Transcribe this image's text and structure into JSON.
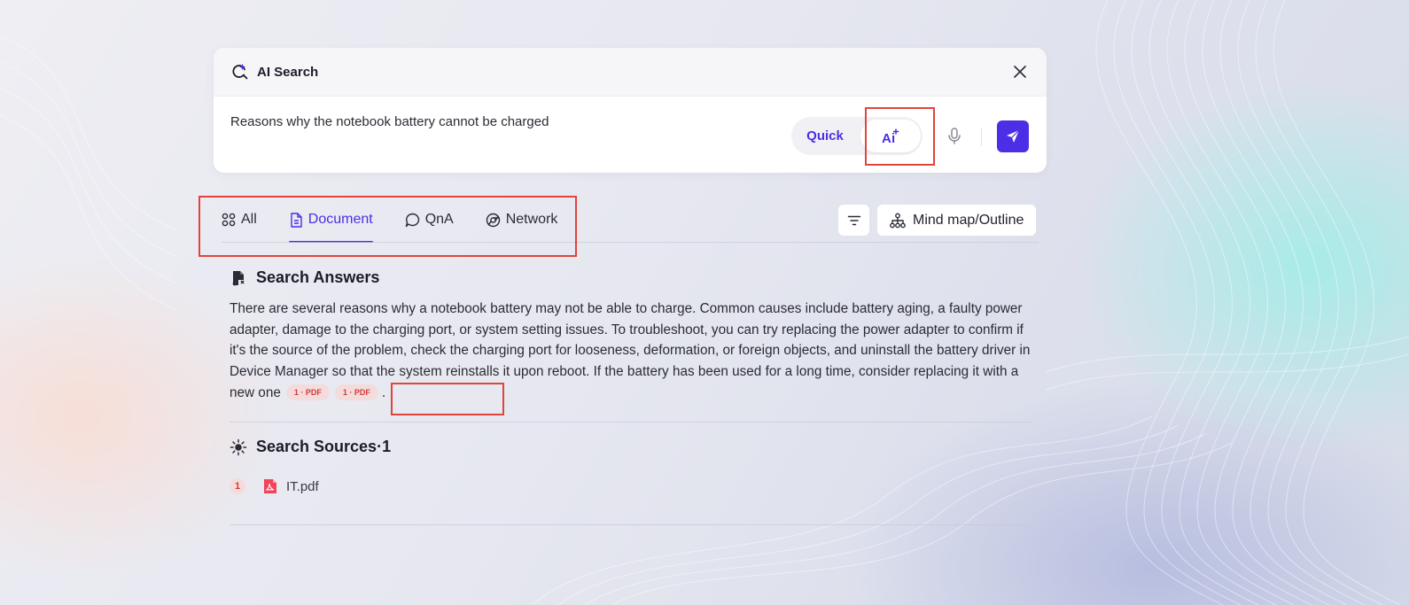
{
  "search_panel": {
    "title": "AI Search",
    "query": "Reasons why the notebook battery cannot be charged",
    "mode_quick_label": "Quick",
    "mode_ai_label": "Ai"
  },
  "tabs": [
    {
      "label": "All",
      "icon": "grid-icon"
    },
    {
      "label": "Document",
      "icon": "document-icon",
      "active": true
    },
    {
      "label": "QnA",
      "icon": "chat-bubble-icon"
    },
    {
      "label": "Network",
      "icon": "network-icon"
    }
  ],
  "toolbar": {
    "filter_icon": "filter-icon",
    "mindmap_label": "Mind map/Outline"
  },
  "answers": {
    "title": "Search Answers",
    "text": "There are several reasons why a notebook battery may not be able to charge. Common causes include battery aging, a faulty power adapter, damage to the charging port, or system setting issues. To troubleshoot, you can try replacing the power adapter to confirm if it's the source of the problem, check the charging port for looseness, deformation, or foreign objects, and uninstall the battery driver in Device Manager so that the system reinstalls it upon reboot. If the battery has been used for a long time, consider replacing it with a new one",
    "citations": [
      "1 · PDF",
      "1 · PDF"
    ],
    "end_punct": "."
  },
  "sources": {
    "title": "Search Sources·1",
    "items": [
      {
        "index": "1",
        "filename": "IT.pdf"
      }
    ]
  },
  "colors": {
    "accent": "#4b2ee5",
    "citation_text": "#d33a3a",
    "citation_bg": "#f4dcdc",
    "annotation_red": "#e0453b"
  }
}
